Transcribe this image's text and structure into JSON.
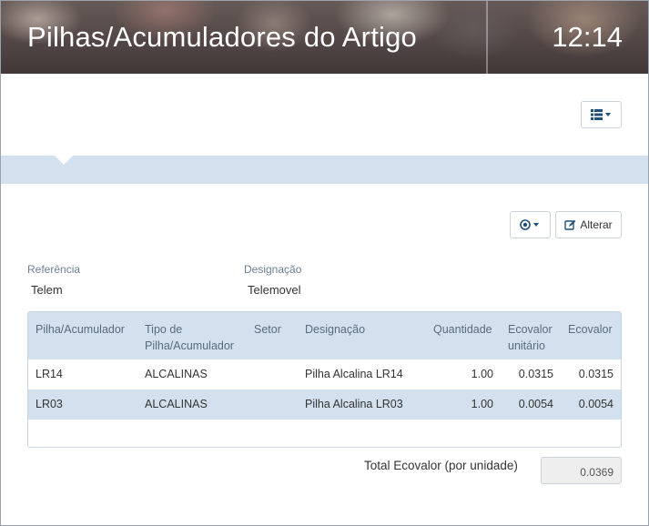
{
  "header": {
    "title": "Pilhas/Acumuladores do Artigo",
    "clock": "12:14"
  },
  "toolbar": {
    "list_icon": "list-icon",
    "options_icon": "options-circle-icon",
    "edit_label": "Alterar",
    "edit_icon": "edit-icon"
  },
  "fields": {
    "referencia": {
      "label": "Referência",
      "value": "Telem"
    },
    "designacao": {
      "label": "Designação",
      "value": "Telemovel"
    }
  },
  "table": {
    "columns": [
      {
        "line1": "Pilha/Acumulador",
        "line2": ""
      },
      {
        "line1": "Tipo de",
        "line2": "Pilha/Acumulador"
      },
      {
        "line1": "Setor",
        "line2": ""
      },
      {
        "line1": "Designação",
        "line2": ""
      },
      {
        "line1": "Quantidade",
        "line2": ""
      },
      {
        "line1": "Ecovalor",
        "line2": "unitário"
      },
      {
        "line1": "Ecovalor",
        "line2": ""
      }
    ],
    "rows": [
      {
        "pilha": "LR14",
        "tipo": "ALCALINAS",
        "setor": "",
        "designacao": "Pilha Alcalina LR14",
        "quantidade": "1.00",
        "ecovalor_unitario": "0.0315",
        "ecovalor": "0.0315"
      },
      {
        "pilha": "LR03",
        "tipo": "ALCALINAS",
        "setor": "",
        "designacao": "Pilha Alcalina LR03",
        "quantidade": "1.00",
        "ecovalor_unitario": "0.0054",
        "ecovalor": "0.0054"
      }
    ]
  },
  "total": {
    "label": "Total Ecovalor (por unidade)",
    "value": "0.0369"
  },
  "colors": {
    "accent_band": "#d3e1ef",
    "label_text": "#6a7f96"
  }
}
